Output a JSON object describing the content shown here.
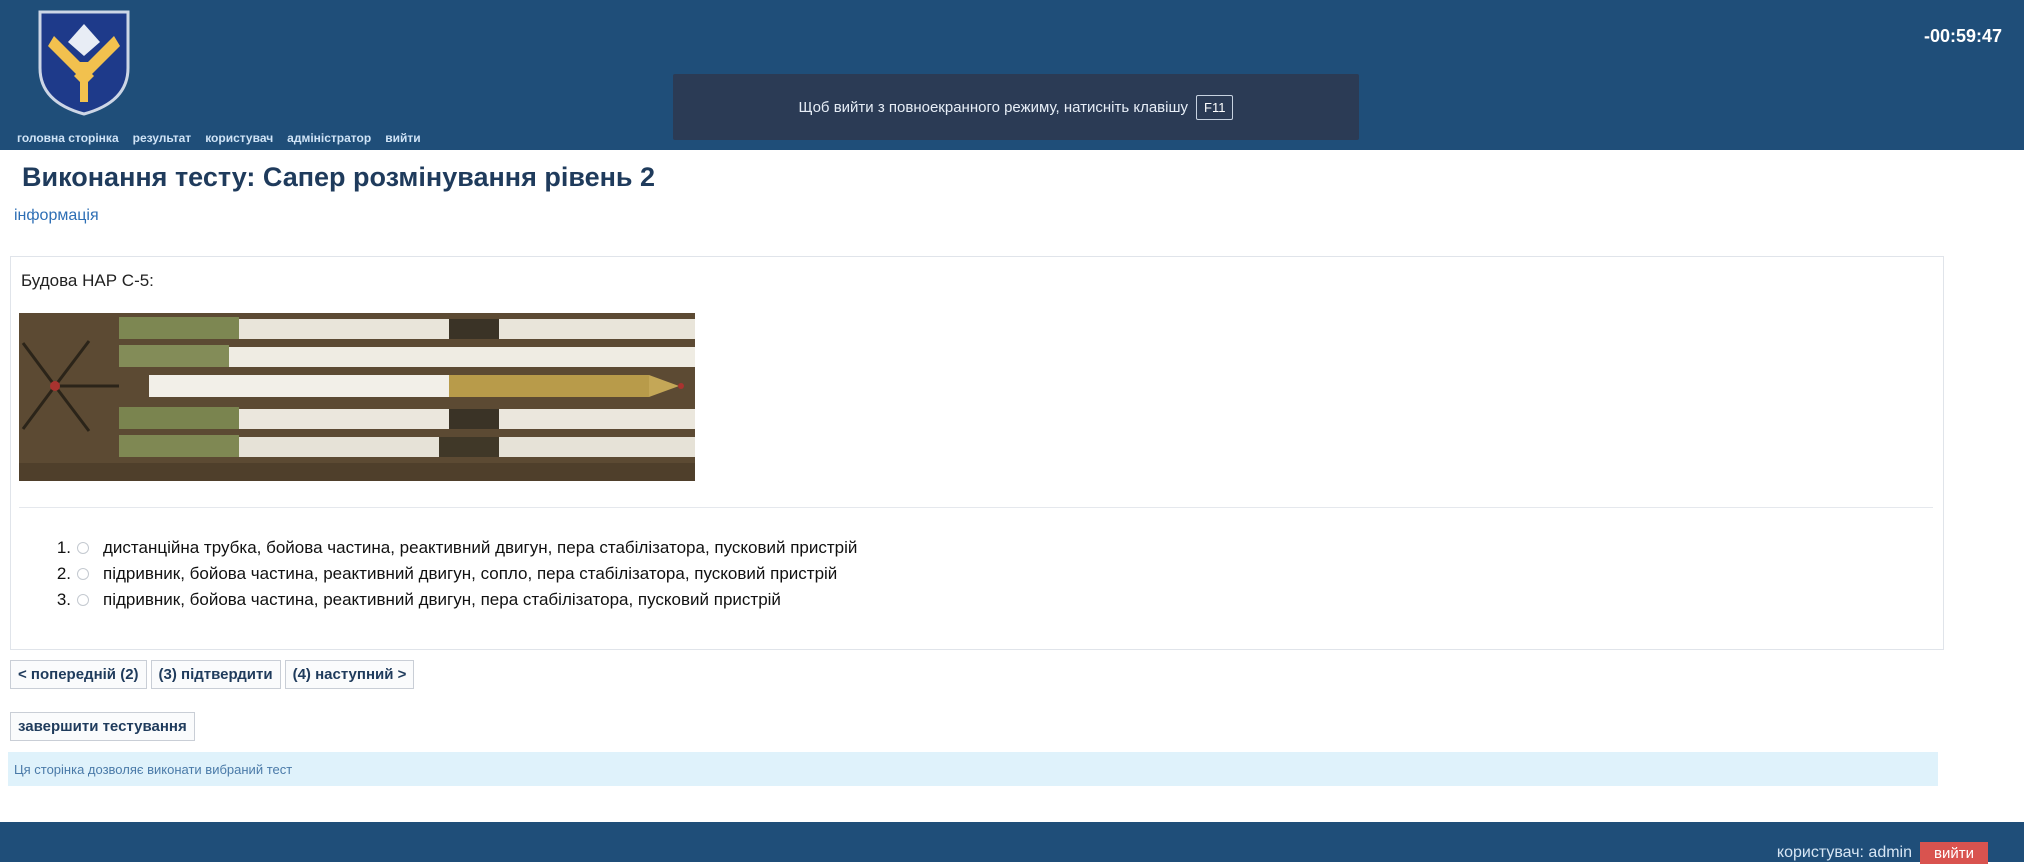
{
  "header": {
    "nav": [
      "головна сторінка",
      "результат",
      "користувач",
      "адміністратор",
      "вийти"
    ],
    "timer": "-00:59:47",
    "fullscreen_notice": "Щоб вийти з повноекранного режиму, натисніть клавішу",
    "fullscreen_key": "F11"
  },
  "main": {
    "title": "Виконання тесту: Сапер розмінування рівень 2",
    "info_link": "інформація",
    "question": "Будова НАР С-5:",
    "answers": [
      {
        "number": "1.",
        "text": "дистанційна трубка, бойова частина, реактивний двигун, пера стабілізатора, пусковий пристрій"
      },
      {
        "number": "2.",
        "text": "підривник, бойова частина, реактивний двигун, сопло, пера стабілізатора, пусковий пристрій"
      },
      {
        "number": "3.",
        "text": "підривник, бойова частина, реактивний двигун, пера стабілізатора, пусковий пристрій"
      }
    ],
    "buttons": {
      "prev": "< попередній (2)",
      "confirm": "(3) підтвердити",
      "next": "(4) наступний >",
      "finish": "завершити тестування"
    },
    "status": "Ця сторінка дозволяє виконати вибраний тест"
  },
  "footer": {
    "user": "користувач: admin",
    "logout": "вийти"
  }
}
